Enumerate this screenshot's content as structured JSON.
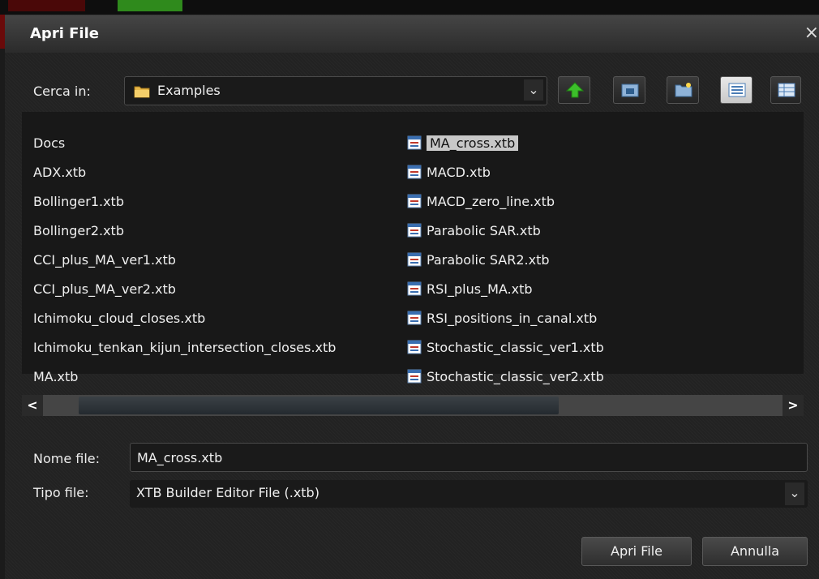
{
  "dialog": {
    "title": "Apri File",
    "close_glyph": "×"
  },
  "look_in": {
    "label": "Cerca in:",
    "value": "Examples",
    "icon": "folder-icon"
  },
  "toolbar": {
    "buttons": [
      {
        "name": "up-folder-icon"
      },
      {
        "name": "home-folder-icon"
      },
      {
        "name": "new-folder-icon"
      },
      {
        "name": "list-view-icon"
      },
      {
        "name": "details-view-icon"
      }
    ]
  },
  "files": {
    "column1": [
      "Docs",
      "ADX.xtb",
      "Bollinger1.xtb",
      "Bollinger2.xtb",
      "CCI_plus_MA_ver1.xtb",
      "CCI_plus_MA_ver2.xtb",
      "Ichimoku_cloud_closes.xtb",
      "Ichimoku_tenkan_kijun_intersection_closes.xtb",
      "MA.xtb"
    ],
    "column2": [
      "MA_cross.xtb",
      "MACD.xtb",
      "MACD_zero_line.xtb",
      "Parabolic SAR.xtb",
      "Parabolic SAR2.xtb",
      "RSI_plus_MA.xtb",
      "RSI_positions_in_canal.xtb",
      "Stochastic_classic_ver1.xtb",
      "Stochastic_classic_ver2.xtb"
    ],
    "selected": "MA_cross.xtb"
  },
  "filename": {
    "label": "Nome file:",
    "value": "MA_cross.xtb"
  },
  "filetype": {
    "label": "Tipo file:",
    "value": "XTB Builder Editor File (.xtb)"
  },
  "buttons": {
    "open": "Apri File",
    "cancel": "Annulla"
  },
  "colors": {
    "accent_green": "#2f8a1c",
    "folder_yellow": "#e8b84a",
    "selection": "#c8c8c8"
  }
}
